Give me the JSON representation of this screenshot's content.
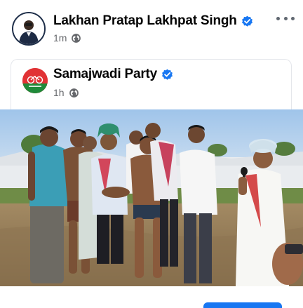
{
  "post": {
    "author": "Lakhan Pratap Lakhpat Singh",
    "time": "1m",
    "author_verified": true
  },
  "shared_post": {
    "author": "Samajwadi Party",
    "time": "1h",
    "author_verified": true
  },
  "icons": {
    "verified": "verified-badge-icon",
    "audience": "globe-icon",
    "more": "more-options-icon"
  },
  "colors": {
    "verified_blue": "#1877f2",
    "party_red": "#e13235",
    "party_green": "#1f8a3a",
    "meta_gray": "#65676b"
  }
}
